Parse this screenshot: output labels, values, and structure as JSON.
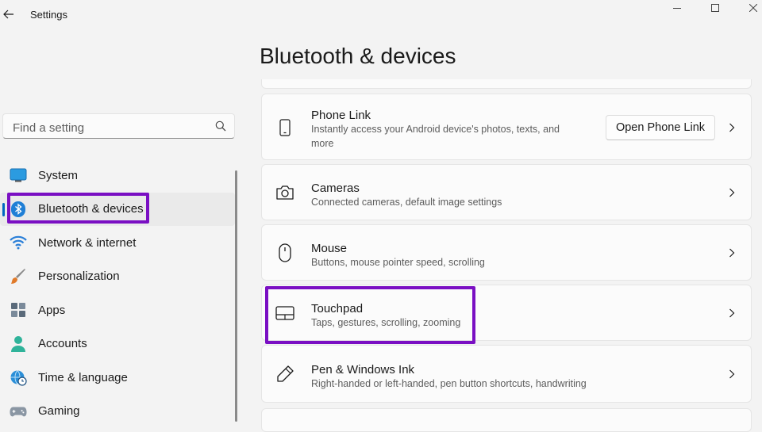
{
  "window": {
    "title": "Settings"
  },
  "search": {
    "placeholder": "Find a setting"
  },
  "sidebar": {
    "items": [
      {
        "label": "System",
        "icon": "monitor-icon"
      },
      {
        "label": "Bluetooth & devices",
        "icon": "bluetooth-icon",
        "selected": true
      },
      {
        "label": "Network & internet",
        "icon": "wifi-icon"
      },
      {
        "label": "Personalization",
        "icon": "brush-icon"
      },
      {
        "label": "Apps",
        "icon": "apps-icon"
      },
      {
        "label": "Accounts",
        "icon": "person-icon"
      },
      {
        "label": "Time & language",
        "icon": "globe-clock-icon"
      },
      {
        "label": "Gaming",
        "icon": "controller-icon"
      }
    ]
  },
  "main": {
    "title": "Bluetooth & devices",
    "cards": [
      {
        "title": "Phone Link",
        "subtitle": "Instantly access your Android device's photos, texts, and more",
        "button": "Open Phone Link",
        "icon": "phone-icon"
      },
      {
        "title": "Cameras",
        "subtitle": "Connected cameras, default image settings",
        "icon": "camera-icon"
      },
      {
        "title": "Mouse",
        "subtitle": "Buttons, mouse pointer speed, scrolling",
        "icon": "mouse-icon"
      },
      {
        "title": "Touchpad",
        "subtitle": "Taps, gestures, scrolling, zooming",
        "icon": "touchpad-icon"
      },
      {
        "title": "Pen & Windows Ink",
        "subtitle": "Right-handed or left-handed, pen button shortcuts, handwriting",
        "icon": "pen-icon"
      }
    ]
  },
  "colors": {
    "accent": "#0067c0",
    "highlight": "#7a0fc3",
    "background": "#f3f3f3",
    "card": "#fbfbfb"
  }
}
